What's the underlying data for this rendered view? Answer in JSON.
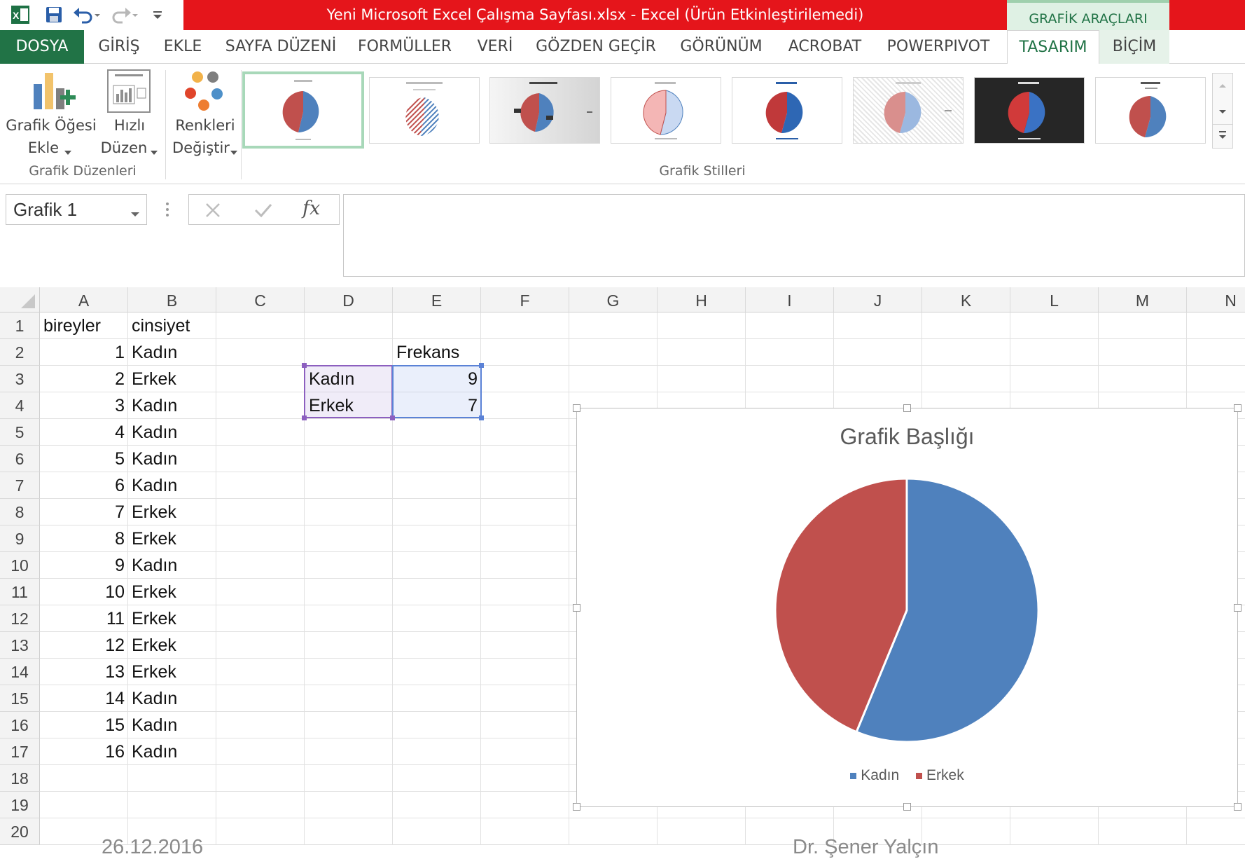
{
  "window": {
    "title": "Yeni Microsoft Excel Çalışma Sayfası.xlsx -  Excel (Ürün Etkinleştirilemedi)",
    "contextual_tab_group": "GRAFİK ARAÇLARI"
  },
  "ribbon_tabs": [
    "DOSYA",
    "GİRİŞ",
    "EKLE",
    "SAYFA DÜZENİ",
    "FORMÜLLER",
    "VERİ",
    "GÖZDEN GEÇİR",
    "GÖRÜNÜM",
    "ACROBAT",
    "POWERPIVOT",
    "TASARIM",
    "BİÇİM"
  ],
  "active_tab": "TASARIM",
  "ribbon": {
    "btn_add_element": {
      "line1": "Grafik Öğesi",
      "line2": "Ekle"
    },
    "btn_quick_layout": {
      "line1": "Hızlı",
      "line2": "Düzen"
    },
    "btn_change_colors": {
      "line1": "Renkleri",
      "line2": "Değiştir"
    },
    "group_layouts": "Grafik Düzenleri",
    "group_styles": "Grafik Stilleri",
    "style_count": 8
  },
  "formula_bar": {
    "name_box": "Grafik 1",
    "fx": "fx",
    "value": ""
  },
  "sheet": {
    "columns": [
      "A",
      "B",
      "C",
      "D",
      "E",
      "F",
      "G",
      "H",
      "I",
      "J",
      "K",
      "L",
      "M",
      "N"
    ],
    "rows": [
      "1",
      "2",
      "3",
      "4",
      "5",
      "6",
      "7",
      "8",
      "9",
      "10",
      "11",
      "12",
      "13",
      "14",
      "15",
      "16",
      "17",
      "18",
      "19",
      "20"
    ],
    "header_a": "bireyler",
    "header_b": "cinsiyet",
    "records": [
      {
        "id": "1",
        "g": "Kadın"
      },
      {
        "id": "2",
        "g": "Erkek"
      },
      {
        "id": "3",
        "g": "Kadın"
      },
      {
        "id": "4",
        "g": "Kadın"
      },
      {
        "id": "5",
        "g": "Kadın"
      },
      {
        "id": "6",
        "g": "Kadın"
      },
      {
        "id": "7",
        "g": "Erkek"
      },
      {
        "id": "8",
        "g": "Erkek"
      },
      {
        "id": "9",
        "g": "Kadın"
      },
      {
        "id": "10",
        "g": "Erkek"
      },
      {
        "id": "11",
        "g": "Erkek"
      },
      {
        "id": "12",
        "g": "Erkek"
      },
      {
        "id": "13",
        "g": "Erkek"
      },
      {
        "id": "14",
        "g": "Kadın"
      },
      {
        "id": "15",
        "g": "Kadın"
      },
      {
        "id": "16",
        "g": "Kadın"
      }
    ],
    "freq_header": "Frekans",
    "freq": [
      {
        "label": "Kadın",
        "value": "9"
      },
      {
        "label": "Erkek",
        "value": "7"
      }
    ]
  },
  "chart_data": {
    "type": "pie",
    "title": "Grafik Başlığı",
    "categories": [
      "Kadın",
      "Erkek"
    ],
    "values": [
      9,
      7
    ],
    "colors": [
      "#4f81bd",
      "#c0504d"
    ],
    "legend": "bottom"
  },
  "footer": {
    "date": "26.12.2016",
    "author": "Dr. Şener Yalçın"
  }
}
